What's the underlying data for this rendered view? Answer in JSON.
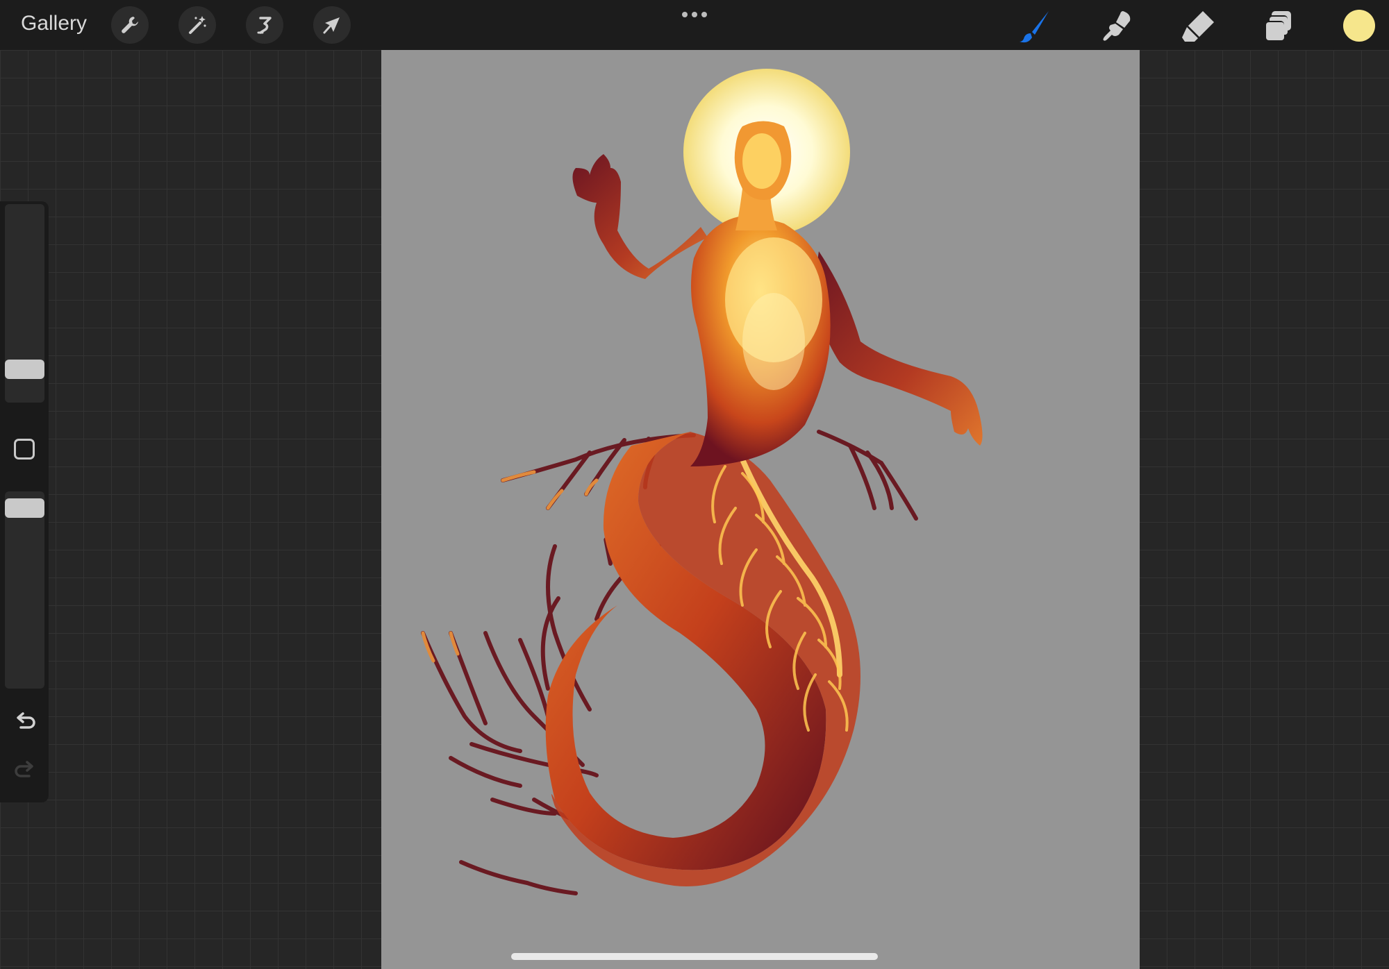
{
  "topbar": {
    "gallery_label": "Gallery",
    "left_tools": [
      "wrench-icon",
      "magic-wand-icon",
      "selection-icon",
      "transform-arrow-icon"
    ],
    "right_tools": [
      "brush-icon",
      "smudge-icon",
      "eraser-icon",
      "layers-icon"
    ],
    "active_tool": "brush-icon",
    "active_color": "#f6e68c",
    "accent_color": "#1a73e8"
  },
  "sidebar": {
    "brush_size_level": 0.24,
    "opacity_level": 0.94,
    "undo_enabled": true,
    "redo_enabled": false
  },
  "canvas": {
    "background_color": "#959595",
    "artwork": "serpent-mermaid-figure-with-halo"
  }
}
